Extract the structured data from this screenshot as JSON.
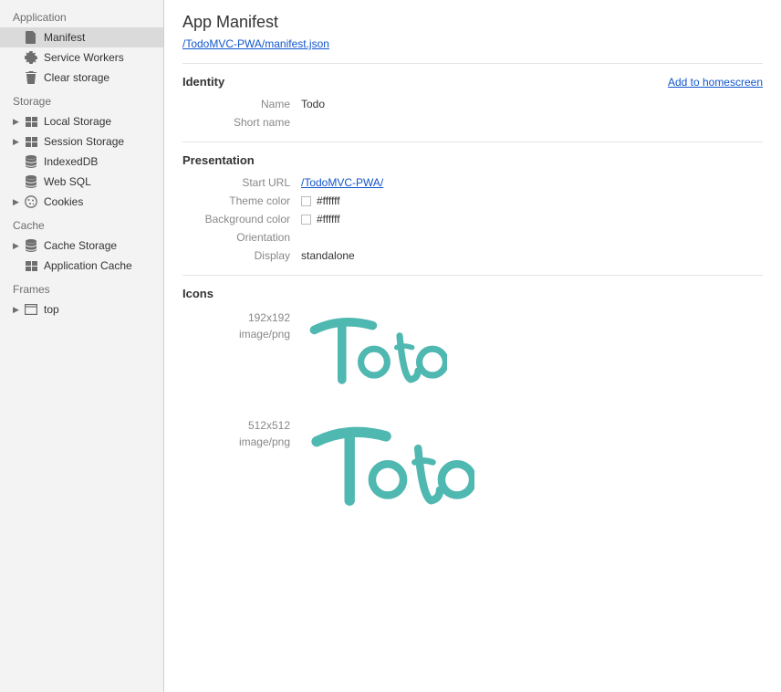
{
  "sidebar": {
    "sections": [
      {
        "title": "Application",
        "items": [
          {
            "label": "Manifest"
          },
          {
            "label": "Service Workers"
          },
          {
            "label": "Clear storage"
          }
        ]
      },
      {
        "title": "Storage",
        "items": [
          {
            "label": "Local Storage"
          },
          {
            "label": "Session Storage"
          },
          {
            "label": "IndexedDB"
          },
          {
            "label": "Web SQL"
          },
          {
            "label": "Cookies"
          }
        ]
      },
      {
        "title": "Cache",
        "items": [
          {
            "label": "Cache Storage"
          },
          {
            "label": "Application Cache"
          }
        ]
      },
      {
        "title": "Frames",
        "items": [
          {
            "label": "top"
          }
        ]
      }
    ]
  },
  "main": {
    "title": "App Manifest",
    "manifest_link": "/TodoMVC-PWA/manifest.json",
    "identity": {
      "heading": "Identity",
      "add_link": "Add to homescreen",
      "name_key": "Name",
      "name_val": "Todo",
      "short_name_key": "Short name",
      "short_name_val": ""
    },
    "presentation": {
      "heading": "Presentation",
      "start_url_key": "Start URL",
      "start_url_val": "/TodoMVC-PWA/",
      "theme_color_key": "Theme color",
      "theme_color_val": "#ffffff",
      "bg_color_key": "Background color",
      "bg_color_val": "#ffffff",
      "orientation_key": "Orientation",
      "orientation_val": "",
      "display_key": "Display",
      "display_val": "standalone"
    },
    "icons": {
      "heading": "Icons",
      "entries": [
        {
          "size": "192x192",
          "type": "image/png"
        },
        {
          "size": "512x512",
          "type": "image/png"
        }
      ]
    },
    "colors": {
      "icon_teal": "#4fb8b0",
      "link": "#1155cc"
    }
  }
}
